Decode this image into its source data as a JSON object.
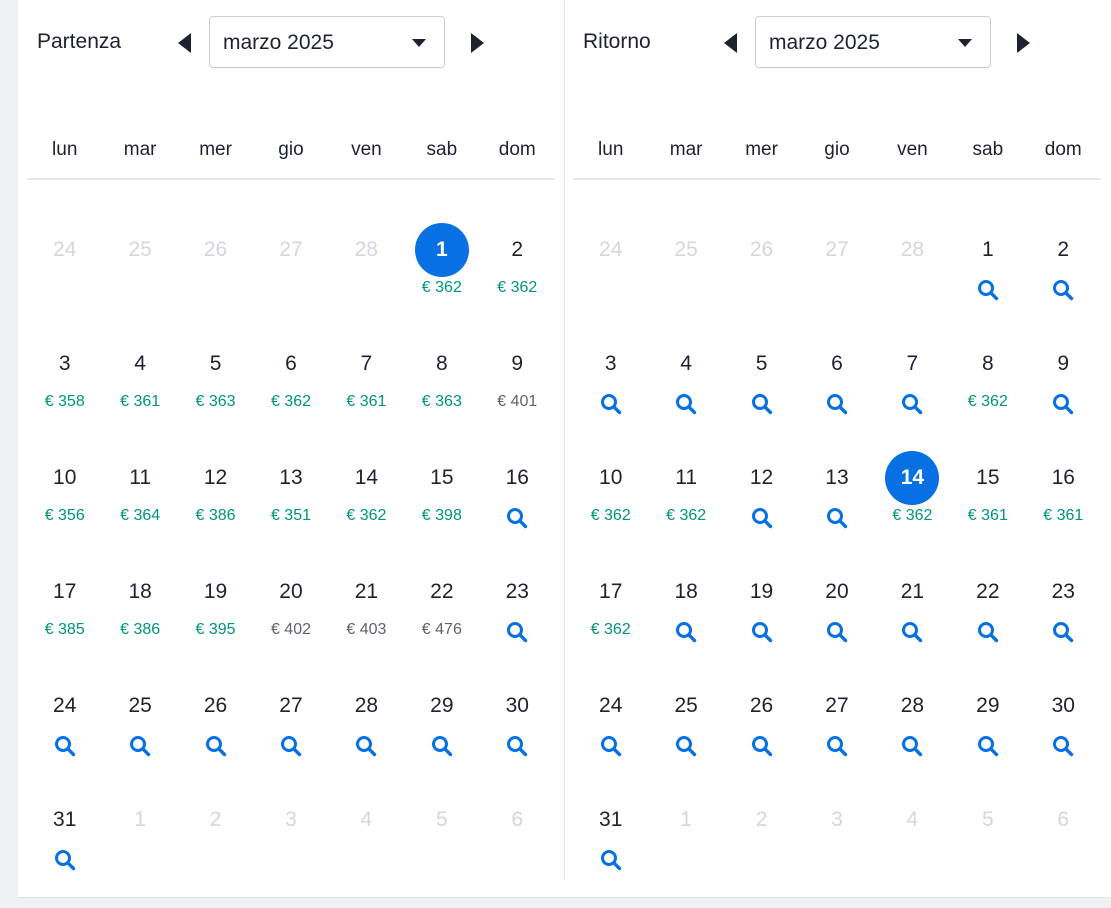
{
  "colors": {
    "accent": "#0770e3",
    "price_green": "#00947d",
    "price_gray": "#5e6270",
    "text": "#1e2230",
    "muted": "#d3d6dc"
  },
  "departure": {
    "label": "Partenza",
    "month": "marzo 2025",
    "prev_icon": "caret-left-icon",
    "next_icon": "caret-right-icon",
    "weekdays": [
      "lun",
      "mar",
      "mer",
      "gio",
      "ven",
      "sab",
      "dom"
    ],
    "days": [
      {
        "n": "24",
        "out": true
      },
      {
        "n": "25",
        "out": true
      },
      {
        "n": "26",
        "out": true
      },
      {
        "n": "27",
        "out": true
      },
      {
        "n": "28",
        "out": true
      },
      {
        "n": "1",
        "selected": true,
        "price": "€ 362"
      },
      {
        "n": "2",
        "price": "€ 362"
      },
      {
        "n": "3",
        "price": "€ 358"
      },
      {
        "n": "4",
        "price": "€ 361"
      },
      {
        "n": "5",
        "price": "€ 363"
      },
      {
        "n": "6",
        "price": "€ 362"
      },
      {
        "n": "7",
        "price": "€ 361"
      },
      {
        "n": "8",
        "price": "€ 363"
      },
      {
        "n": "9",
        "price": "€ 401",
        "high": true
      },
      {
        "n": "10",
        "price": "€ 356"
      },
      {
        "n": "11",
        "price": "€ 364"
      },
      {
        "n": "12",
        "price": "€ 386"
      },
      {
        "n": "13",
        "price": "€ 351"
      },
      {
        "n": "14",
        "price": "€ 362"
      },
      {
        "n": "15",
        "price": "€ 398"
      },
      {
        "n": "16",
        "search": true
      },
      {
        "n": "17",
        "price": "€ 385"
      },
      {
        "n": "18",
        "price": "€ 386"
      },
      {
        "n": "19",
        "price": "€ 395"
      },
      {
        "n": "20",
        "price": "€ 402",
        "high": true
      },
      {
        "n": "21",
        "price": "€ 403",
        "high": true
      },
      {
        "n": "22",
        "price": "€ 476",
        "high": true
      },
      {
        "n": "23",
        "search": true
      },
      {
        "n": "24",
        "search": true
      },
      {
        "n": "25",
        "search": true
      },
      {
        "n": "26",
        "search": true
      },
      {
        "n": "27",
        "search": true
      },
      {
        "n": "28",
        "search": true
      },
      {
        "n": "29",
        "search": true
      },
      {
        "n": "30",
        "search": true
      },
      {
        "n": "31",
        "search": true
      },
      {
        "n": "1",
        "out": true
      },
      {
        "n": "2",
        "out": true
      },
      {
        "n": "3",
        "out": true
      },
      {
        "n": "4",
        "out": true
      },
      {
        "n": "5",
        "out": true
      },
      {
        "n": "6",
        "out": true
      }
    ]
  },
  "return": {
    "label": "Ritorno",
    "month": "marzo 2025",
    "prev_icon": "caret-left-icon",
    "next_icon": "caret-right-icon",
    "weekdays": [
      "lun",
      "mar",
      "mer",
      "gio",
      "ven",
      "sab",
      "dom"
    ],
    "days": [
      {
        "n": "24",
        "out": true
      },
      {
        "n": "25",
        "out": true
      },
      {
        "n": "26",
        "out": true
      },
      {
        "n": "27",
        "out": true
      },
      {
        "n": "28",
        "out": true
      },
      {
        "n": "1",
        "search": true
      },
      {
        "n": "2",
        "search": true
      },
      {
        "n": "3",
        "search": true
      },
      {
        "n": "4",
        "search": true
      },
      {
        "n": "5",
        "search": true
      },
      {
        "n": "6",
        "search": true
      },
      {
        "n": "7",
        "search": true
      },
      {
        "n": "8",
        "price": "€ 362"
      },
      {
        "n": "9",
        "search": true
      },
      {
        "n": "10",
        "price": "€ 362"
      },
      {
        "n": "11",
        "price": "€ 362"
      },
      {
        "n": "12",
        "search": true
      },
      {
        "n": "13",
        "search": true
      },
      {
        "n": "14",
        "selected": true,
        "price": "€ 362"
      },
      {
        "n": "15",
        "price": "€ 361"
      },
      {
        "n": "16",
        "price": "€ 361"
      },
      {
        "n": "17",
        "price": "€ 362"
      },
      {
        "n": "18",
        "search": true
      },
      {
        "n": "19",
        "search": true
      },
      {
        "n": "20",
        "search": true
      },
      {
        "n": "21",
        "search": true
      },
      {
        "n": "22",
        "search": true
      },
      {
        "n": "23",
        "search": true
      },
      {
        "n": "24",
        "search": true
      },
      {
        "n": "25",
        "search": true
      },
      {
        "n": "26",
        "search": true
      },
      {
        "n": "27",
        "search": true
      },
      {
        "n": "28",
        "search": true
      },
      {
        "n": "29",
        "search": true
      },
      {
        "n": "30",
        "search": true
      },
      {
        "n": "31",
        "search": true
      },
      {
        "n": "1",
        "out": true
      },
      {
        "n": "2",
        "out": true
      },
      {
        "n": "3",
        "out": true
      },
      {
        "n": "4",
        "out": true
      },
      {
        "n": "5",
        "out": true
      },
      {
        "n": "6",
        "out": true
      }
    ]
  }
}
